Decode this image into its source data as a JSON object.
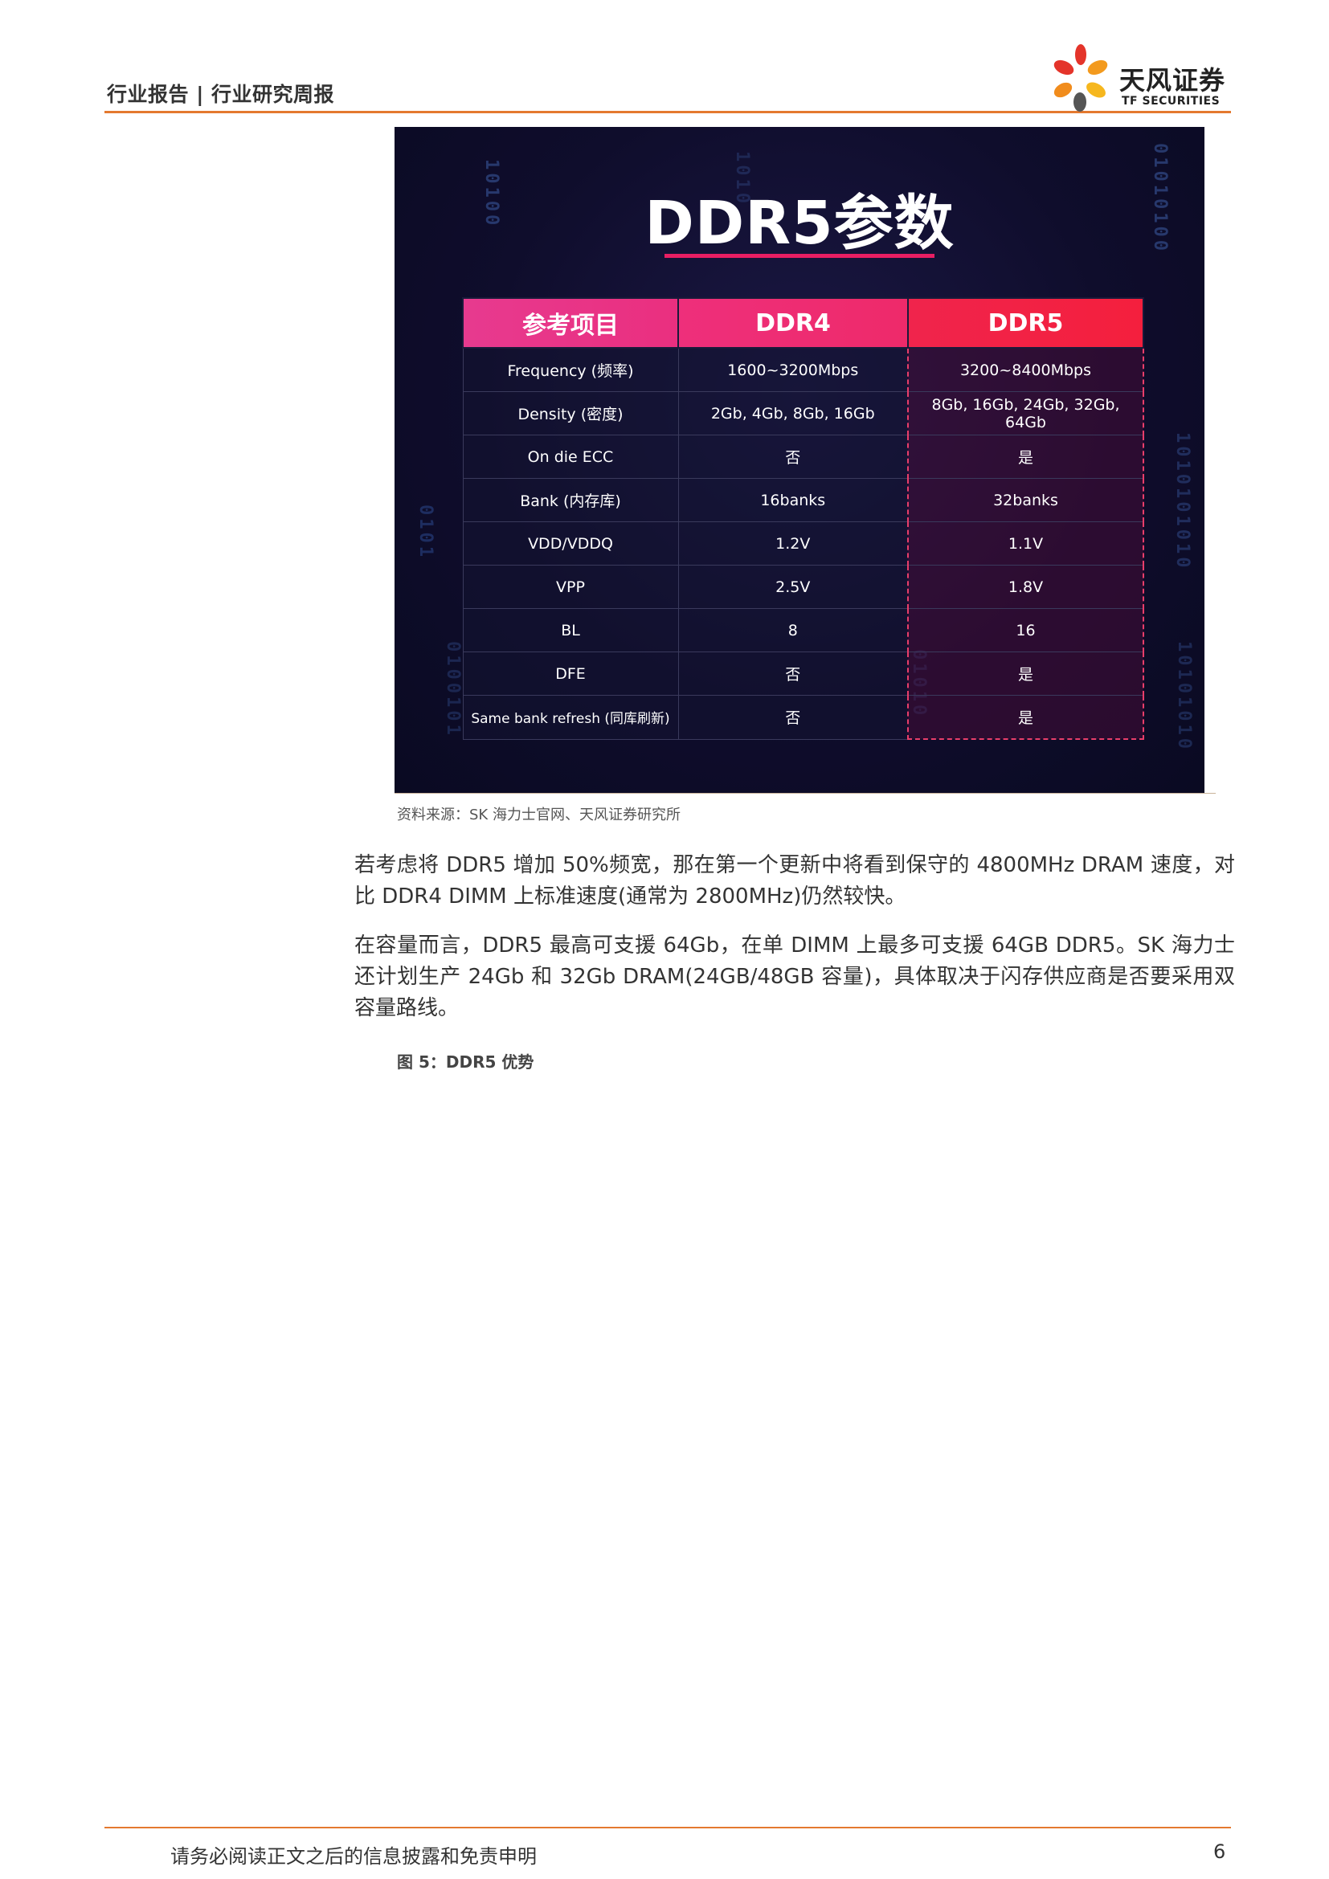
{
  "header": {
    "title": "行业报告 | 行业研究周报",
    "logo_cn": "天风证券",
    "logo_en": "TF SECURITIES"
  },
  "figure": {
    "title": "DDR5参数",
    "binary_text": [
      "10100",
      "0101",
      "01010100",
      "1010101010",
      "1010",
      "01010",
      "10101010",
      "0100101"
    ],
    "table": {
      "headers": [
        "参考项目",
        "DDR4",
        "DDR5"
      ],
      "rows": [
        [
          "Frequency (频率)",
          "1600~3200Mbps",
          "3200~8400Mbps"
        ],
        [
          "Density (密度)",
          "2Gb, 4Gb, 8Gb, 16Gb",
          "8Gb, 16Gb, 24Gb, 32Gb, 64Gb"
        ],
        [
          "On die ECC",
          "否",
          "是"
        ],
        [
          "Bank (内存库)",
          "16banks",
          "32banks"
        ],
        [
          "VDD/VDDQ",
          "1.2V",
          "1.1V"
        ],
        [
          "VPP",
          "2.5V",
          "1.8V"
        ],
        [
          "BL",
          "8",
          "16"
        ],
        [
          "DFE",
          "否",
          "是"
        ],
        [
          "Same bank refresh (同库刷新)",
          "否",
          "是"
        ]
      ]
    },
    "source": "资料来源：SK 海力士官网、天风证券研究所"
  },
  "body": {
    "paragraph1": "若考虑将 DDR5 增加 50%频宽，那在第一个更新中将看到保守的 4800MHz DRAM 速度，对比 DDR4 DIMM 上标准速度(通常为 2800MHz)仍然较快。",
    "paragraph2": "在容量而言，DDR5 最高可支援 64Gb，在单 DIMM 上最多可支援 64GB DDR5。SK 海力士还计划生产 24Gb 和 32Gb DRAM(24GB/48GB 容量)，具体取决于闪存供应商是否要采用双容量路线。",
    "figure5_caption": "图 5：DDR5 优势"
  },
  "footer": {
    "disclaimer": "请务必阅读正文之后的信息披露和免责申明",
    "page_number": "6"
  },
  "colors": {
    "accent_orange": "#e4792f",
    "header_pink": "#e73a8f",
    "header_red": "#f41f3d",
    "figure_bg": "#0f0d2c"
  }
}
